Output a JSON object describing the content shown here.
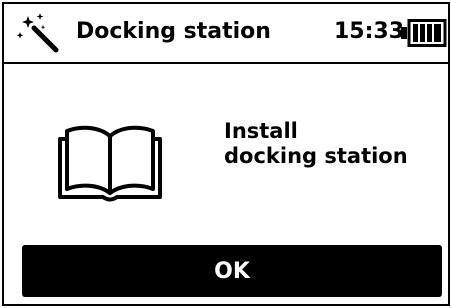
{
  "header": {
    "title": "Docking station",
    "time": "15:33",
    "left_icon": "magic-wand-icon",
    "battery": {
      "icon": "battery-icon",
      "level": 1.0
    }
  },
  "content": {
    "icon": "book-icon",
    "message_line1": "Install",
    "message_line2": "docking station"
  },
  "actions": {
    "ok_label": "OK"
  },
  "colors": {
    "background": "#ffffff",
    "foreground": "#000000",
    "button_bg": "#000000",
    "button_text": "#ffffff"
  }
}
